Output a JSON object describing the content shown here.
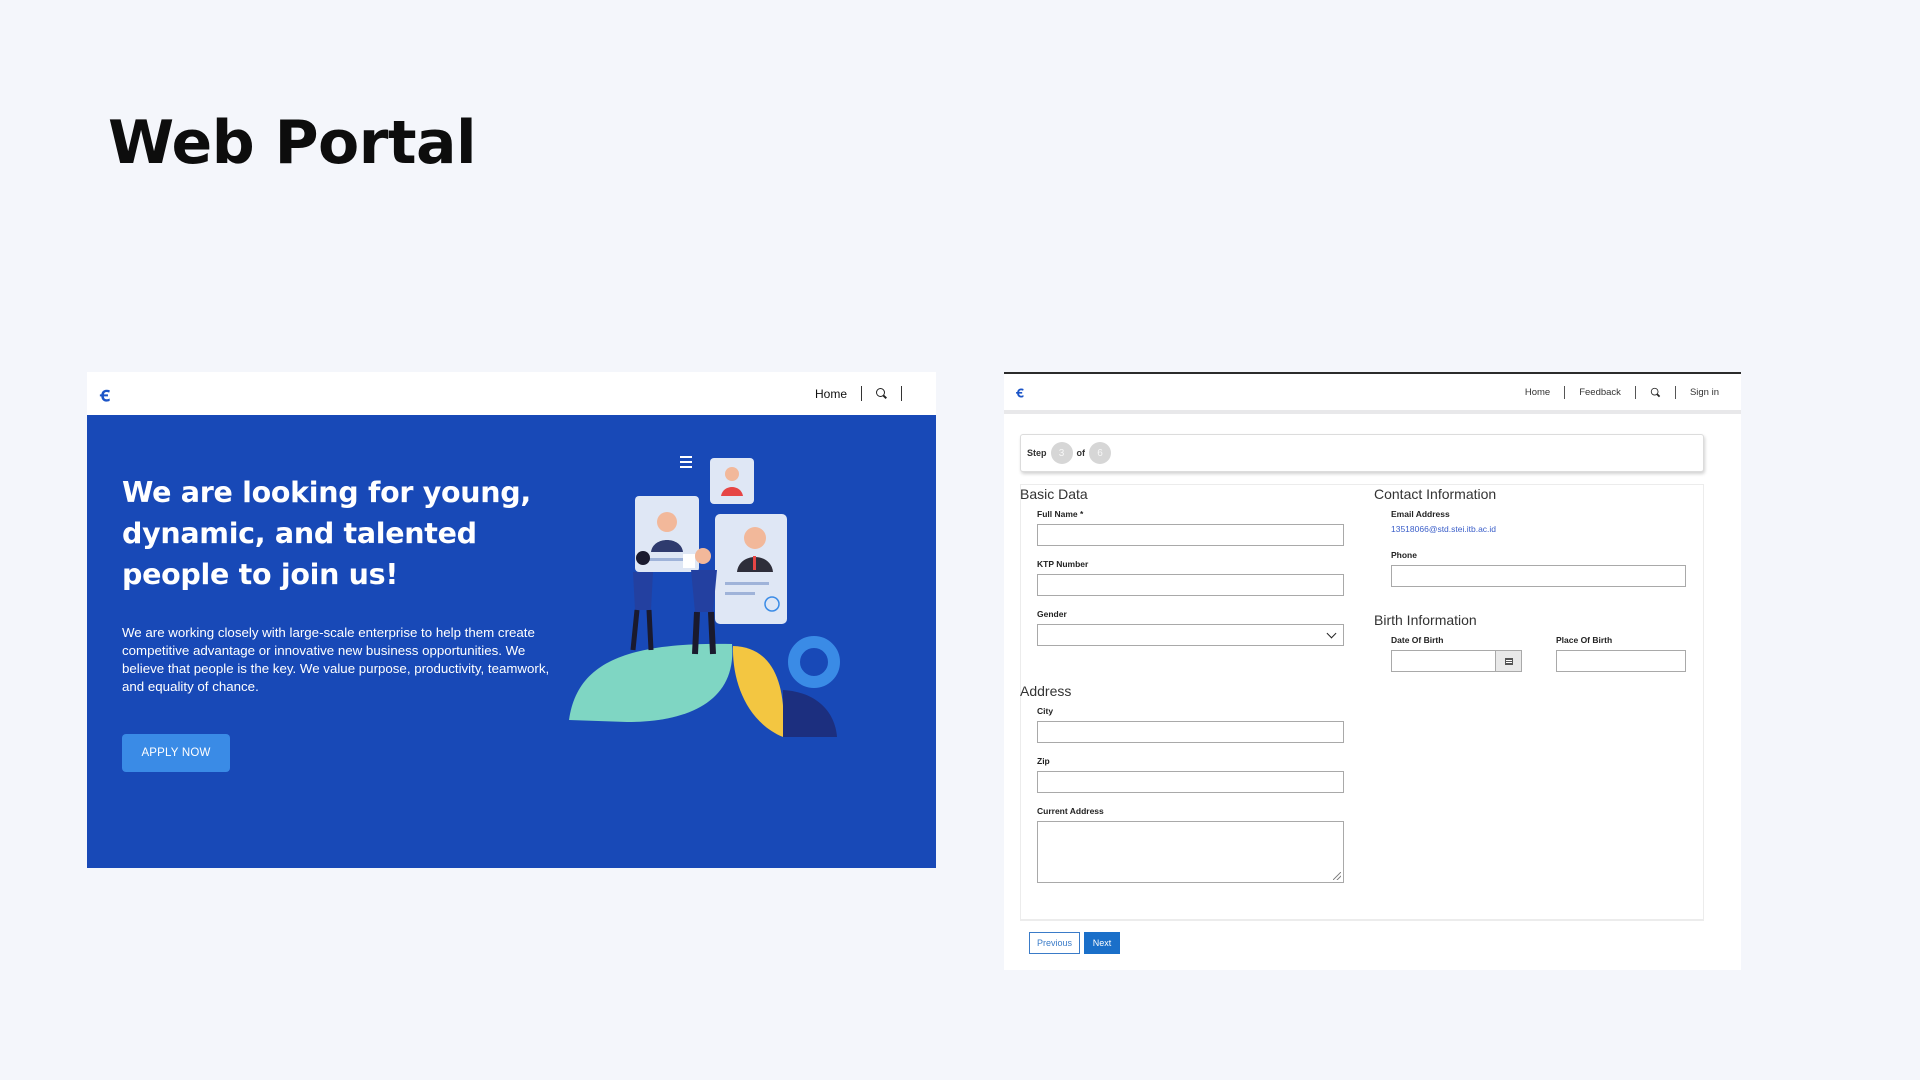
{
  "slide": {
    "title": "Web Portal"
  },
  "landing": {
    "logo": "ꞓ",
    "nav": {
      "home": "Home"
    },
    "hero_title": "We are looking for young, dynamic, and talented people to join us!",
    "hero_text": "We are working closely with large-scale enterprise to help them create competitive advantage or innovative new business opportunities. We believe that people is the key. We value purpose, productivity, teamwork, and equality of chance.",
    "apply_button": "APPLY NOW",
    "colors": {
      "hero_bg": "#1849b7",
      "button": "#3a8be6"
    }
  },
  "form": {
    "logo": "ꞓ",
    "nav": {
      "home": "Home",
      "feedback": "Feedback",
      "signin": "Sign in"
    },
    "stepper": {
      "step_label": "Step",
      "current": "3",
      "of_label": "of",
      "total": "6"
    },
    "basic_data": {
      "heading": "Basic Data",
      "full_name_label": "Full Name *",
      "ktp_label": "KTP Number",
      "gender_label": "Gender"
    },
    "address": {
      "heading": "Address",
      "city_label": "City",
      "zip_label": "Zip",
      "current_address_label": "Current Address"
    },
    "contact": {
      "heading": "Contact Information",
      "email_label": "Email Address",
      "email_value": "13518066@std.stei.itb.ac.id",
      "phone_label": "Phone"
    },
    "birth": {
      "heading": "Birth Information",
      "dob_label": "Date Of Birth",
      "pob_label": "Place Of Birth"
    },
    "buttons": {
      "previous": "Previous",
      "next": "Next"
    }
  }
}
